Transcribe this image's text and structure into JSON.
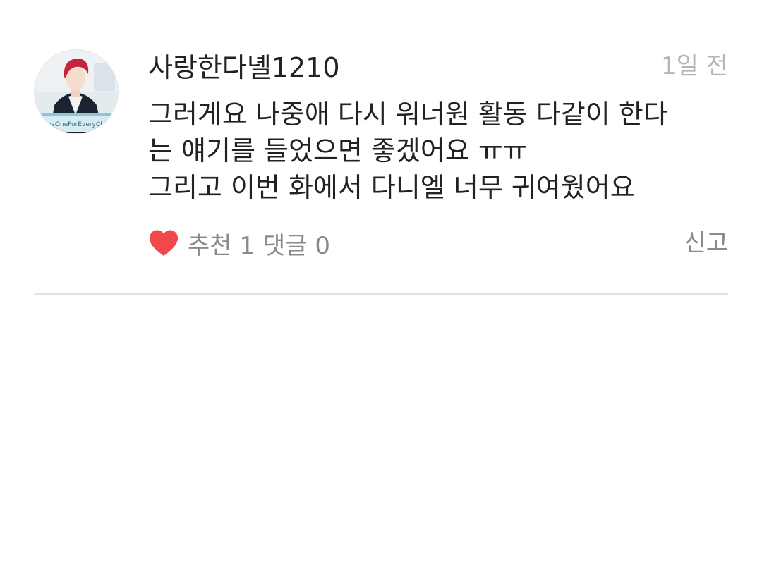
{
  "comment": {
    "username": "사랑한다녤1210",
    "timestamp": "1일 전",
    "body_lines": [
      "그러게요 나중애 다시 워너원 활동 다같이 한다",
      "는 얘기를 들었으면 좋겠어요 ㅠㅠ",
      "그리고 이번 화에서 다니엘 너무 귀여웠어요"
    ],
    "avatar_caption": "nnaOneForEveryChild"
  },
  "actions": {
    "like_label": "추천",
    "like_count": "1",
    "reply_label": "댓글",
    "reply_count": "0",
    "report_label": "신고"
  },
  "colors": {
    "heart": "#f0484c",
    "muted_text": "#8a8a8a",
    "timestamp_text": "#b5b5b5",
    "divider": "#e3e3e3"
  },
  "icons": {
    "like": "heart-icon",
    "avatar": "avatar"
  }
}
